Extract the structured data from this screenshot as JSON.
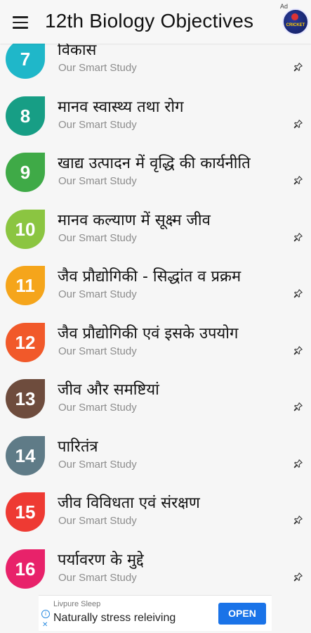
{
  "app_bar": {
    "title": "12th Biology Objectives",
    "ad_mark": "Ad",
    "ad_logo_label": "CRICKET",
    "icons": {
      "menu": "hamburger-menu-icon",
      "ad_logo": "cricket-app-logo"
    }
  },
  "items": [
    {
      "number": "7",
      "title": "विकास",
      "subtitle": "Our Smart Study",
      "color": "#1fb7c9"
    },
    {
      "number": "8",
      "title": "मानव स्वास्थ्य तथा रोग",
      "subtitle": "Our Smart Study",
      "color": "#179e85"
    },
    {
      "number": "9",
      "title": "खाद्य उत्पादन में वृद्धि की कार्यनीति",
      "subtitle": "Our Smart Study",
      "color": "#3faa47"
    },
    {
      "number": "10",
      "title": "मानव कल्याण में सूक्ष्म जीव",
      "subtitle": "Our Smart Study",
      "color": "#8bc541"
    },
    {
      "number": "11",
      "title": "जैव प्रौद्योगिकी - सिद्धांत व प्रक्रम",
      "subtitle": "Our Smart Study",
      "color": "#f5a51b"
    },
    {
      "number": "12",
      "title": "जैव प्रौद्योगिकी एवं इसके उपयोग",
      "subtitle": "Our Smart Study",
      "color": "#f1592a"
    },
    {
      "number": "13",
      "title": "जीव और समष्टियां",
      "subtitle": "Our Smart Study",
      "color": "#6e4c3d"
    },
    {
      "number": "14",
      "title": "पारितंत्र",
      "subtitle": "Our Smart Study",
      "color": "#5f7b87"
    },
    {
      "number": "15",
      "title": "जीव विविधता एवं संरक्षण",
      "subtitle": "Our Smart Study",
      "color": "#ee3a33"
    },
    {
      "number": "16",
      "title": "पर्यावरण के मुद्दे",
      "subtitle": "Our Smart Study",
      "color": "#e8226a"
    }
  ],
  "pin_icon": "pushpin-icon",
  "ad_banner": {
    "brand": "Livpure Sleep",
    "tagline": "Naturally stress releiving",
    "button_label": "OPEN",
    "accent_color": "#1a73e8",
    "icons": {
      "info": "ad-info-icon",
      "close": "ad-close-icon"
    }
  }
}
